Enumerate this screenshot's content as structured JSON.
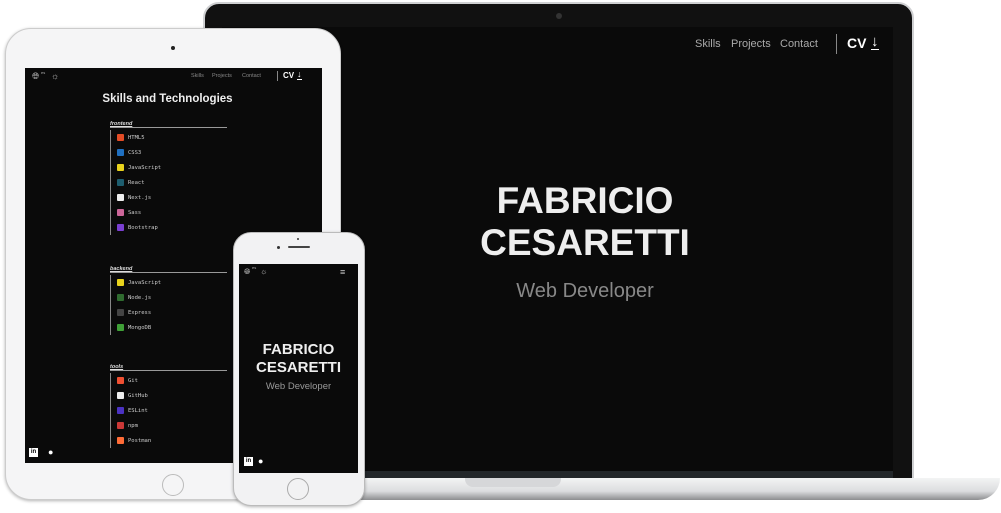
{
  "laptop": {
    "nav": [
      "Skills",
      "Projects",
      "Contact"
    ],
    "cv_label": "CV",
    "download_icon": "download-icon",
    "name_line1": "FABRICIO",
    "name_line2": "CESARETTI",
    "role": "Web Developer"
  },
  "tablet": {
    "lang_badge": "es",
    "nav": [
      "Skills",
      "Projects",
      "Contact"
    ],
    "cv_label": "CV",
    "title": "Skills and Technologies",
    "categories": [
      {
        "name": "frontend",
        "items": [
          {
            "label": "HTML5",
            "color": "#e34c26"
          },
          {
            "label": "CSS3",
            "color": "#1f6fc0"
          },
          {
            "label": "JavaScript",
            "color": "#e8d21c"
          },
          {
            "label": "React",
            "color": "#1d5d6e"
          },
          {
            "label": "Next.js",
            "color": "#eeeeee"
          },
          {
            "label": "Sass",
            "color": "#cc6699"
          },
          {
            "label": "Bootstrap",
            "color": "#7a3fd1"
          }
        ]
      },
      {
        "name": "backend",
        "items": [
          {
            "label": "JavaScript",
            "color": "#e8d21c"
          },
          {
            "label": "Node.js",
            "color": "#2f6b2f"
          },
          {
            "label": "Express",
            "color": "#444444"
          },
          {
            "label": "MongoDB",
            "color": "#3fa037"
          }
        ]
      },
      {
        "name": "tools",
        "items": [
          {
            "label": "Git",
            "color": "#f05032"
          },
          {
            "label": "GitHub",
            "color": "#eeeeee"
          },
          {
            "label": "ESLint",
            "color": "#4b32c3"
          },
          {
            "label": "npm",
            "color": "#cb3837"
          },
          {
            "label": "Postman",
            "color": "#ff6c37"
          }
        ]
      }
    ]
  },
  "phone": {
    "lang_badge": "es",
    "name_line1": "FABRICIO",
    "name_line2": "CESARETTI",
    "role": "Web Developer"
  }
}
